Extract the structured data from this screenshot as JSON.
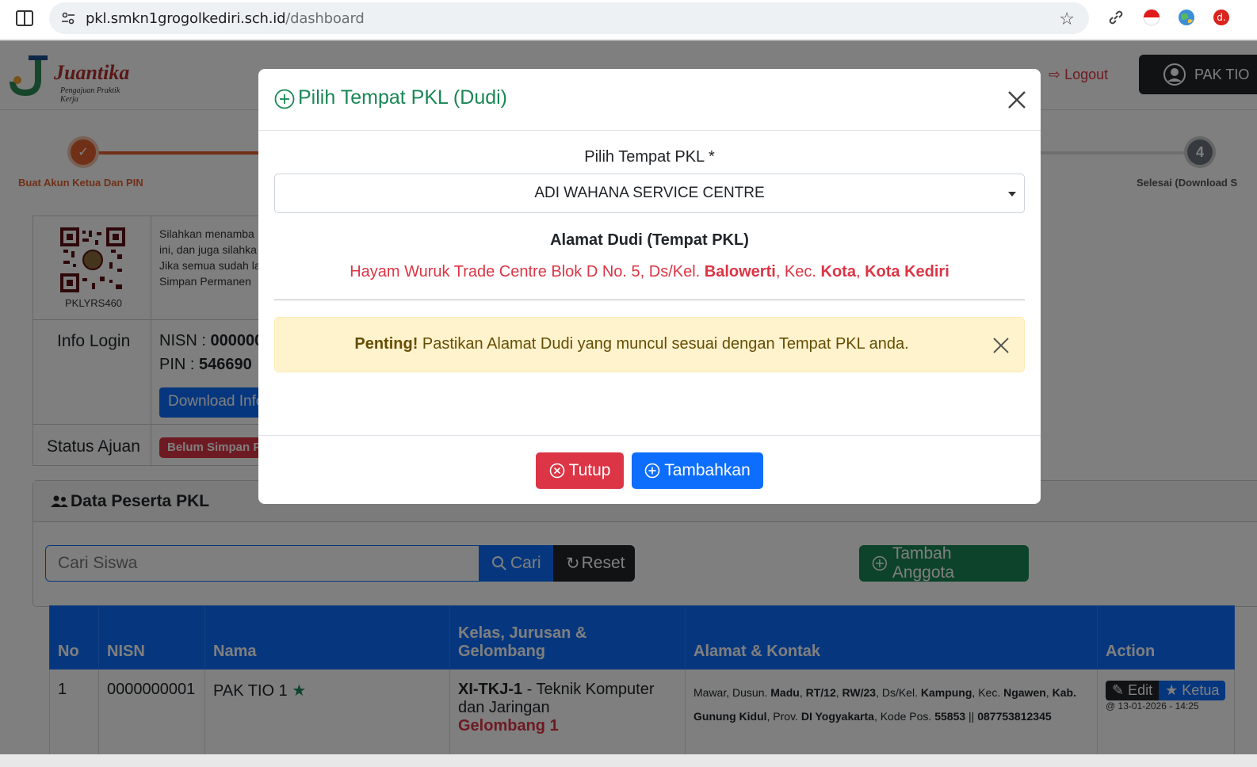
{
  "browser": {
    "url_host": "pkl.smkn1grogolkediri.sch.id",
    "url_path": "/dashboard"
  },
  "nav": {
    "logo_title": "Juantika",
    "logo_subtitle": "Pengajuan Praktik Kerja",
    "logout_label": "Logout",
    "user_label": "PAK TIO"
  },
  "stepper": {
    "step1_label": "Buat Akun Ketua Dan PIN",
    "step4_number": "4",
    "step4_label": "Selesai (Download S"
  },
  "info": {
    "qr_code_label": "PKLYRS460",
    "instructions_lines": [
      "Silahkan menamba",
      "ini, dan juga silahka",
      "Jika semua sudah la",
      "Simpan Permanen"
    ],
    "login_label": "Info Login",
    "nisn_label": "NISN : ",
    "nisn_value": "000000",
    "pin_label": "PIN : ",
    "pin_value": "546690",
    "download_label": "Download Info",
    "status_label": "Status Ajuan",
    "status_badge": "Belum Simpan P"
  },
  "peserta": {
    "title": "Data Peserta PKL",
    "search_placeholder": "Cari Siswa",
    "cari_label": "Cari",
    "reset_label": "Reset",
    "tambah_anggota_label": "Tambah Anggota",
    "columns": [
      "No",
      "NISN",
      "Nama",
      "Kelas, Jurusan & Gelombang",
      "Alamat & Kontak",
      "Action"
    ],
    "rows": [
      {
        "no": "1",
        "nisn": "0000000001",
        "nama": "PAK TIO 1",
        "kelas_code": "XI-TKJ-1",
        "kelas_rest": " - Teknik Komputer dan Jaringan",
        "gelombang": "Gelombang 1",
        "alamat": {
          "p1": "Mawar, Dusun. ",
          "dusun": "Madu",
          "rt": "RT/12",
          "rw": "RW/23",
          "p2": ", Ds/Kel. ",
          "desa": "Kampung",
          "p3": ", Kec. ",
          "kec": "Ngawen",
          "kab": "Kab. Gunung Kidul",
          "p4": ", Prov. ",
          "prov": "DI Yogyakarta",
          "p5": ", Kode Pos. ",
          "kodepos": "55853",
          "p6": " || ",
          "telp": "087753812345"
        },
        "edit_label": "Edit",
        "ketua_label": "Ketua",
        "timestamp": "@ 13-01-2026 - 14:25"
      }
    ]
  },
  "modal": {
    "title": "Pilih Tempat PKL (Dudi)",
    "field_label": "Pilih Tempat PKL *",
    "selected_value": "ADI WAHANA SERVICE CENTRE",
    "alamat_title": "Alamat Dudi (Tempat PKL)",
    "alamat_prefix": "Hayam Wuruk Trade Centre Blok D No. 5, Ds/Kel. ",
    "kelurahan": "Balowerti",
    "kec_prefix": ", Kec. ",
    "kecamatan": "Kota",
    "comma": ", ",
    "kota": "Kota Kediri",
    "alert_bold": "Penting!",
    "alert_text": " Pastikan Alamat Dudi yang muncul sesuai dengan Tempat PKL anda.",
    "tutup_label": "Tutup",
    "tambahkan_label": "Tambahkan"
  },
  "colors": {
    "primary": "#0d6efd",
    "danger": "#dc3545",
    "success": "#198754",
    "warning_bg": "#fff3cd",
    "dark": "#212529",
    "accent_orange": "#e0612f"
  }
}
